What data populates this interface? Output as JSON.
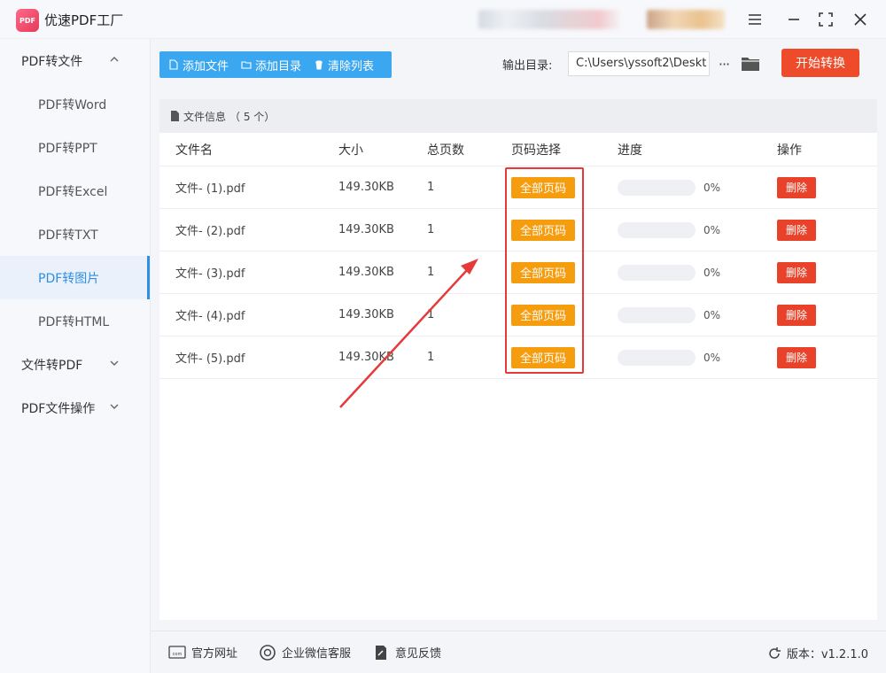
{
  "app": {
    "title": "优速PDF工厂",
    "logo_text": "PDF"
  },
  "sidebar": {
    "groups": [
      {
        "label": "PDF转文件",
        "expanded": true,
        "items": [
          "PDF转Word",
          "PDF转PPT",
          "PDF转Excel",
          "PDF转TXT",
          "PDF转图片",
          "PDF转HTML"
        ],
        "active": "PDF转图片"
      },
      {
        "label": "文件转PDF",
        "expanded": false
      },
      {
        "label": "PDF文件操作",
        "expanded": false
      }
    ]
  },
  "toolbar": {
    "add_file": "添加文件",
    "add_dir": "添加目录",
    "clear_list": "清除列表",
    "output_label": "输出目录:",
    "output_path": "C:\\Users\\yssoft2\\Deskt",
    "more": "···",
    "start": "开始转换"
  },
  "panel": {
    "header": "文件信息",
    "count": "（ 5 个）",
    "columns": [
      "文件名",
      "大小",
      "总页数",
      "页码选择",
      "进度",
      "操作"
    ],
    "rows": [
      {
        "name": "文件- (1).pdf",
        "size": "149.30KB",
        "pages": "1",
        "select": "全部页码",
        "progress": "0%",
        "action": "删除"
      },
      {
        "name": "文件- (2).pdf",
        "size": "149.30KB",
        "pages": "1",
        "select": "全部页码",
        "progress": "0%",
        "action": "删除"
      },
      {
        "name": "文件- (3).pdf",
        "size": "149.30KB",
        "pages": "1",
        "select": "全部页码",
        "progress": "0%",
        "action": "删除"
      },
      {
        "name": "文件- (4).pdf",
        "size": "149.30KB",
        "pages": "1",
        "select": "全部页码",
        "progress": "0%",
        "action": "删除"
      },
      {
        "name": "文件- (5).pdf",
        "size": "149.30KB",
        "pages": "1",
        "select": "全部页码",
        "progress": "0%",
        "action": "删除"
      }
    ]
  },
  "footer": {
    "website": "官方网址",
    "wechat": "企业微信客服",
    "feedback": "意见反馈",
    "version": "版本：v1.2.1.0"
  },
  "colors": {
    "accent": "#3aa7f0",
    "start": "#ee4b2b",
    "select_btn": "#f59d0e",
    "delete_btn": "#e8432a",
    "annotation": "#e53a3a"
  }
}
